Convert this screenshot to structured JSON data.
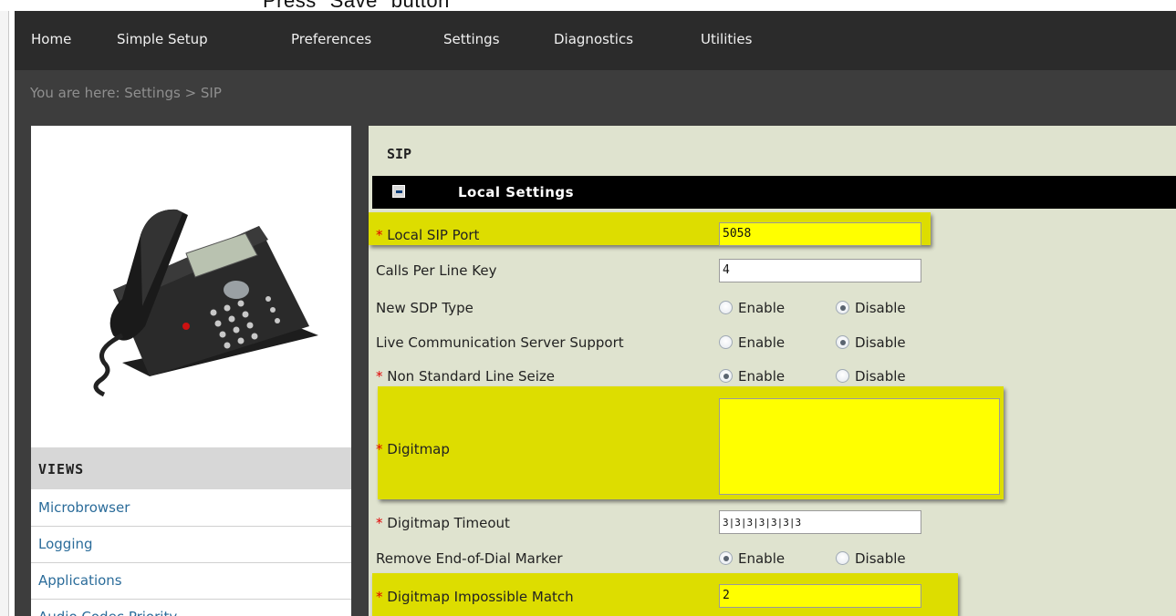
{
  "caption": "Press \"Save\" button",
  "nav": {
    "items": [
      "Home",
      "Simple Setup",
      "Preferences",
      "Settings",
      "Diagnostics",
      "Utilities"
    ]
  },
  "breadcrumb": "You are here: Settings > SIP",
  "left": {
    "views_heading": "VIEWS",
    "views_items": [
      "Microbrowser",
      "Logging",
      "Applications",
      "Audio Codec Priority"
    ]
  },
  "main": {
    "title": "SIP",
    "section": "Local Settings",
    "fields": {
      "local_sip_port": {
        "label": "Local SIP Port",
        "value": "5058",
        "required": true
      },
      "calls_per_line_key": {
        "label": "Calls Per Line Key",
        "value": "4"
      },
      "new_sdp_type": {
        "label": "New SDP Type",
        "selected": "Disable"
      },
      "lcs_support": {
        "label": "Live Communication Server Support",
        "selected": "Disable"
      },
      "non_standard_line_seize": {
        "label": "Non Standard Line Seize",
        "selected": "Enable",
        "required": true
      },
      "digitmap": {
        "label": "Digitmap",
        "value": "",
        "required": true
      },
      "digitmap_timeout": {
        "label": "Digitmap Timeout",
        "value": "3|3|3|3|3|3|3",
        "required": true
      },
      "remove_eod_marker": {
        "label": "Remove End-of-Dial Marker",
        "selected": "Enable"
      },
      "digitmap_impossible_match": {
        "label": "Digitmap Impossible Match",
        "value": "2",
        "required": true
      }
    },
    "radio_labels": {
      "enable": "Enable",
      "disable": "Disable"
    },
    "required_marker": "*"
  },
  "colors": {
    "nav_bg": "#2b2b2b",
    "crumb_bg": "#3d3d3d",
    "panel_bg": "#dfe3cf",
    "highlight": "#dddd00",
    "required": "#e00000",
    "link": "#2b6c9a"
  }
}
